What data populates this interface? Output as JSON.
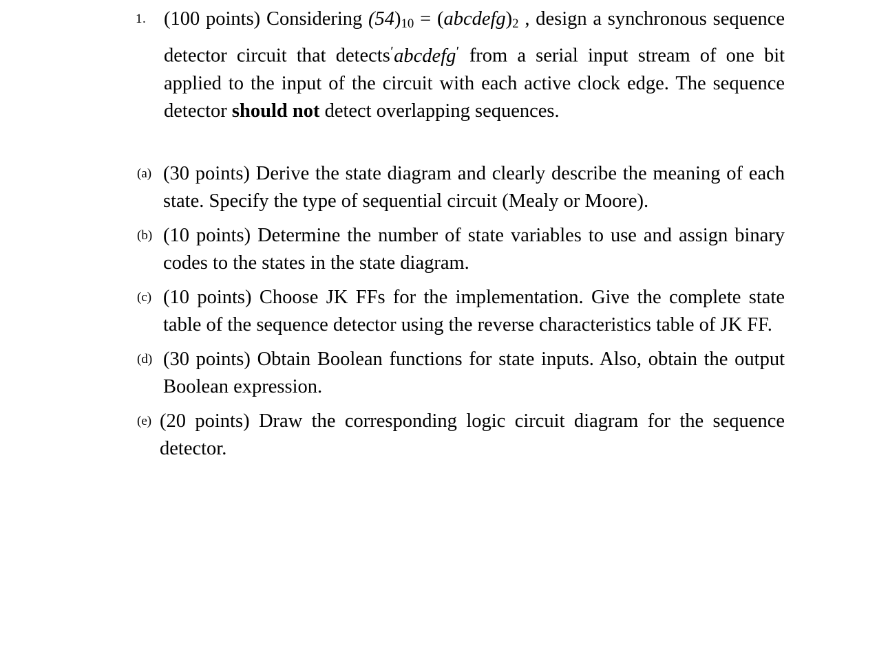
{
  "document": {
    "type": "exam-question-sheet",
    "background_color": "#ffffff",
    "text_color": "#000000"
  },
  "question": {
    "marker": "1.",
    "points_label": "(100 points)",
    "text_before_expr": "Considering",
    "expr_decimal_open": "(",
    "expr_decimal_value": "54",
    "expr_decimal_close": ")",
    "expr_decimal_subscript": "10",
    "equals": "=",
    "expr_binary_open": "(",
    "expr_binary_value": "abcdefg",
    "expr_binary_close": ")",
    "expr_binary_subscript": "2",
    "text_after_expr_line1": ", design a",
    "line2_pre": "synchronous sequence detector circuit that detects",
    "quoted_sequence": "abcdefg",
    "prime_mark": "′",
    "line2_post": "from",
    "line3": "a serial input stream of one bit applied to the input of the circuit",
    "line4_pre": "with each active clock edge. The sequence detector",
    "line4_bold": "should not",
    "line5": "detect overlapping sequences."
  },
  "subparts": [
    {
      "marker": "(a)",
      "points_label": "(30 points)",
      "text": "Derive the state diagram and clearly describe the meaning of each state. Specify the type of sequential circuit (Mealy or Moore)."
    },
    {
      "marker": "(b)",
      "points_label": "(10 points)",
      "text": "Determine the number of state variables to use and assign binary codes to the states in the state diagram."
    },
    {
      "marker": "(c)",
      "points_label": "(10 points)",
      "text": "Choose JK FFs for the implementation. Give the complete state table of the sequence detector using the reverse characteristics table of JK FF."
    },
    {
      "marker": "(d)",
      "points_label": "(30 points)",
      "text": "Obtain Boolean functions for state inputs. Also, obtain the output Boolean expression."
    },
    {
      "marker": "(e)",
      "points_label": "(20 points)",
      "text": "Draw the corresponding logic circuit diagram for the sequence detector."
    }
  ]
}
